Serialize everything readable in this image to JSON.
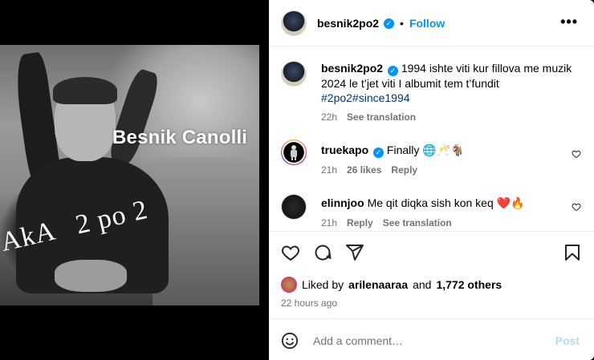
{
  "media": {
    "overlay_name": "Besnik Canolli",
    "overlay_aka": "AkA   2 po 2"
  },
  "header": {
    "username": "besnik2po2",
    "verified": "✓",
    "separator": "•",
    "follow_label": "Follow",
    "more_label": "•••"
  },
  "caption": {
    "username": "besnik2po2",
    "verified": "✓",
    "line1": "1994 ishte viti kur fillova me muzik",
    "line2": "2024 le t’jet viti I albumit tem t’fundit",
    "hashtags": "#2po2#since1994",
    "time": "22h",
    "see_translation": "See translation"
  },
  "comments": [
    {
      "username": "truekapo",
      "verified": "✓",
      "text": "Finally 🌐🥂🐐",
      "time": "21h",
      "likes": "26 likes",
      "reply": "Reply"
    },
    {
      "username": "elinnjoo",
      "text": "Me qit diqka sish kon keq ❤️🔥",
      "time": "21h",
      "reply": "Reply",
      "see_translation": "See translation"
    }
  ],
  "likes": {
    "prefix": "Liked by",
    "user": "arilenaaraa",
    "and": "and",
    "others": "1,772 others"
  },
  "time_ago": "22 hours ago",
  "composer": {
    "placeholder": "Add a comment…",
    "post_label": "Post"
  },
  "icons": [
    "heart-icon",
    "comment-icon",
    "share-icon",
    "bookmark-icon",
    "emoji-icon",
    "more-icon",
    "verified-icon"
  ],
  "colors": {
    "accent": "#0095f6",
    "hashtag": "#00376b",
    "muted": "#737373",
    "post_disabled": "#b3dbff"
  }
}
